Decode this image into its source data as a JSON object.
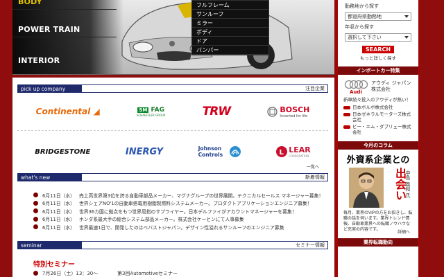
{
  "nav": {
    "items": [
      "BODY",
      "POWER TRAIN",
      "INTERIOR"
    ]
  },
  "dropdown": {
    "items": [
      "フルフレーム",
      "サンルーフ",
      "ミラー",
      "ボディ",
      "ドア",
      "バンパー"
    ]
  },
  "sidebar": {
    "label_area": "勤務地から探す",
    "select_area": "都道府県勤務地",
    "label_age": "年収から探す",
    "select_age": "選択して下さい",
    "search_label": "SEARCH",
    "more_link": "もっと詳しく探す",
    "importer_head": "インポートカー特集",
    "audi_name": "アウディ ジャパン\n株式会社",
    "audi_caption": "新車続々投入のアウディが熱い！",
    "cars": [
      "日本ボルボ株式会社",
      "日本ゼネラルモーターズ株式会社",
      "ビー・エム・ダブリュー株式会社"
    ],
    "column_head": "今月のコラム",
    "column_title": "外資系企業との",
    "column_big": "出会い",
    "column_author": "中島 義和 氏",
    "column_text": "毎月、業界のVIPの方をお招きし、転職の話を伺います。業界トレンド情報、自動車業界への転職ノウハウなど充実の内容です。",
    "column_more": "詳細へ",
    "bottom_head": "業界転職動向"
  },
  "pickup": {
    "label": "pick up company",
    "right": "注目企業",
    "logos_row1": [
      "Continental",
      "FAG",
      "TRW",
      "BOSCH"
    ],
    "bosch_sub": "Invented for life",
    "fag_sub": "SCHAEFFLER GROUP",
    "logos_row2": [
      "BRIDGESTONE",
      "INERGY",
      "Johnson Controls",
      "LEAR"
    ],
    "lear_sub": "CORPORATION",
    "more": "一覧へ"
  },
  "whatsnew": {
    "label": "what's new",
    "right": "新着情報",
    "items": [
      {
        "date": "6月11日（水）",
        "text": "売上高世界第3位を誇る自動車部品メーカー、マグナグループの世界展開。テクニカルセールス マネージャー募集！"
      },
      {
        "date": "6月11日（水）",
        "text": "世界シェアNO'1の自動車搭載用樹脂製燃料システムメーカー。プロダクトアプリケーションエンジニア募集！"
      },
      {
        "date": "6月11日（水）",
        "text": "世界36カ国に拠点をもつ世界屈指のサプライヤー。日本デルファイがアカウントマネージャーを募集！"
      },
      {
        "date": "6月11日（水）",
        "text": "ホンダ系最大手の総合システム部品メーカー。株式会社ケーヒンにて人事募集"
      },
      {
        "date": "6月11日（水）",
        "text": "世界最速1日で、開発したのはベバストジャパン。デザイン性溢れるサンルーフのエンジニア募集"
      }
    ]
  },
  "seminar": {
    "label": "seminar",
    "right": "セミナー情報",
    "title": "特別セミナー",
    "date": "7月26日（土）13：30～",
    "text": "第3回Automotiveセミナー"
  }
}
